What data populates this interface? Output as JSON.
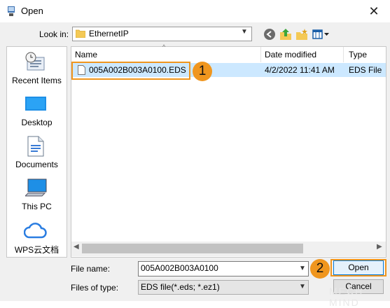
{
  "window": {
    "title": "Open"
  },
  "look_in": {
    "label": "Look in:",
    "value": "EthernetIP"
  },
  "places": [
    {
      "label": "Recent Items",
      "icon": "recent-items-icon"
    },
    {
      "label": "Desktop",
      "icon": "desktop-icon"
    },
    {
      "label": "Documents",
      "icon": "documents-icon"
    },
    {
      "label": "This PC",
      "icon": "this-pc-icon"
    },
    {
      "label": "WPS云文档",
      "icon": "cloud-icon"
    }
  ],
  "file_list": {
    "columns": [
      "Name",
      "Date modified",
      "Type"
    ],
    "rows": [
      {
        "name": "005A002B003A0100.EDS",
        "date": "4/2/2022 11:41 AM",
        "type": "EDS File",
        "selected": true
      }
    ]
  },
  "annotations": {
    "step1": "1",
    "step2": "2",
    "color": "#f0961e"
  },
  "bottom": {
    "file_name_label": "File name:",
    "file_name_value": "005A002B003A0100",
    "files_of_type_label": "Files of type:",
    "files_of_type_value": "EDS file(*.eds; *.ez1)",
    "open_label": "Open",
    "cancel_label": "Cancel"
  },
  "watermark": "MECH MIND"
}
